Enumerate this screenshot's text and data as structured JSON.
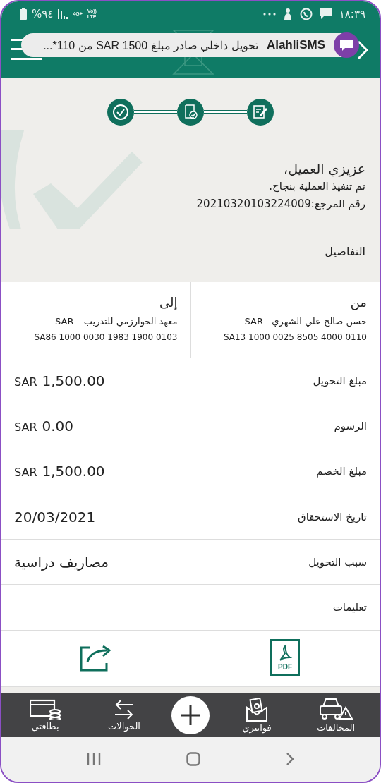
{
  "status_bar": {
    "time": "١٨:٣٩",
    "battery": "%٩٤",
    "network": "4G+",
    "volte": "Vo))",
    "lte": "LTE"
  },
  "notification": {
    "app": "AlahliSMS",
    "message": "تحويل داخلي صادر  مبلغ 1500 SAR من 110*..."
  },
  "steps": [
    {
      "kind": "edit"
    },
    {
      "kind": "review"
    },
    {
      "kind": "done"
    }
  ],
  "message": {
    "greeting": "عزيزي العميل،",
    "status": "تم تنفيذ العملية بنجاح.",
    "reference": "رقم المرجع:20210320103224009"
  },
  "details_title": "التفاصيل",
  "parties": [
    {
      "label": "من",
      "name": "حسن صالح علي الشهري",
      "currency": "SAR",
      "iban": "SA13 1000 0025 8505 4000 0110"
    },
    {
      "label": "إلى",
      "name": "معهد الخوارزمي للتدريب",
      "currency": "SAR",
      "iban": "SA86 1000 0030 1983 1900 0103"
    }
  ],
  "rows": [
    {
      "kind": "amount",
      "label": "مبلغ التحويل",
      "currency": "SAR",
      "value": "1,500.00"
    },
    {
      "kind": "amount",
      "label": "الرسوم",
      "currency": "SAR",
      "value": "0.00"
    },
    {
      "kind": "amount",
      "label": "مبلغ الخصم",
      "currency": "SAR",
      "value": "1,500.00"
    },
    {
      "kind": "text",
      "label": "تاريخ الاستحقاق",
      "value": "20/03/2021"
    },
    {
      "kind": "text",
      "label": "سبب التحويل",
      "value": "مصاريف دراسية"
    },
    {
      "kind": "text",
      "label": "تعليمات"
    }
  ],
  "actions": [
    {
      "kind": "pdf",
      "label": "PDF"
    },
    {
      "kind": "share"
    }
  ],
  "bottom_nav": [
    {
      "kind": "car",
      "label": "المخالفات"
    },
    {
      "kind": "bills",
      "label": "فواتيري"
    },
    {
      "kind": "add"
    },
    {
      "kind": "transfers",
      "label": "الحوالات"
    },
    {
      "kind": "cards",
      "label": "بطاقتى"
    }
  ]
}
